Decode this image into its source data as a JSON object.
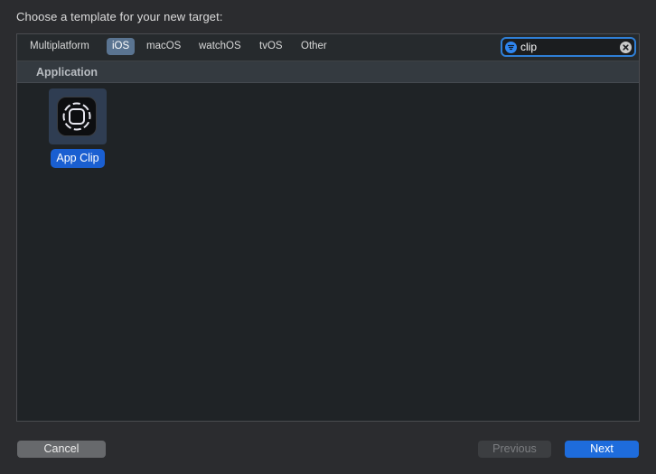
{
  "header": {
    "title": "Choose a template for your new target:"
  },
  "platform_tabs": [
    {
      "label": "Multiplatform",
      "active": false
    },
    {
      "label": "iOS",
      "active": true
    },
    {
      "label": "macOS",
      "active": false
    },
    {
      "label": "watchOS",
      "active": false
    },
    {
      "label": "tvOS",
      "active": false
    },
    {
      "label": "Other",
      "active": false
    }
  ],
  "search": {
    "value": "clip",
    "icon": "filter-icon",
    "clear_icon": "clear-icon"
  },
  "sections": [
    {
      "title": "Application",
      "templates": [
        {
          "label": "App Clip",
          "icon": "app-clip-icon",
          "selected": true
        }
      ]
    }
  ],
  "footer": {
    "cancel_label": "Cancel",
    "previous_label": "Previous",
    "next_label": "Next",
    "previous_enabled": false
  },
  "colors": {
    "accent": "#1e6cdc",
    "active_tab": "#5a7491",
    "panel_bg": "#1f2326"
  }
}
